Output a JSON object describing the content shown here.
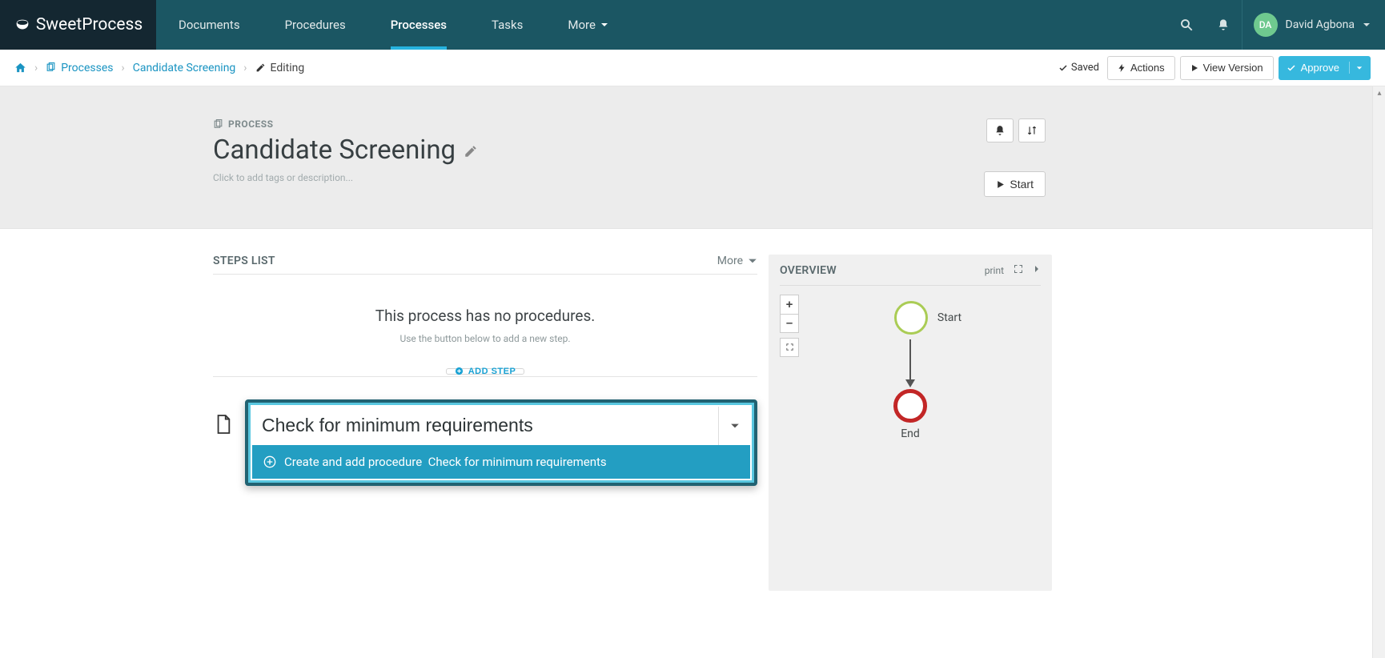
{
  "brand": {
    "name1": "Sweet",
    "name2": "Process"
  },
  "nav": {
    "documents": "Documents",
    "procedures": "Procedures",
    "processes": "Processes",
    "tasks": "Tasks",
    "more": "More"
  },
  "user": {
    "initials": "DA",
    "name": "David Agbona"
  },
  "breadcrumb": {
    "processes": "Processes",
    "current_item": "Candidate Screening",
    "editing": "Editing"
  },
  "subbar": {
    "saved": "Saved",
    "actions": "Actions",
    "view_version": "View Version",
    "approve": "Approve"
  },
  "header": {
    "type_label": "PROCESS",
    "title": "Candidate Screening",
    "desc_placeholder": "Click to add tags or description...",
    "start": "Start"
  },
  "steps": {
    "heading": "STEPS LIST",
    "more": "More",
    "empty_title": "This process has no procedures.",
    "empty_sub": "Use the button below to add a new step.",
    "add_step": "ADD STEP",
    "input_value": "Check for minimum requirements",
    "dropdown_prefix": "Create and add procedure",
    "dropdown_name": "Check for minimum requirements"
  },
  "overview": {
    "heading": "OVERVIEW",
    "print": "print",
    "start": "Start",
    "end": "End",
    "plus": "+",
    "minus": "–"
  }
}
